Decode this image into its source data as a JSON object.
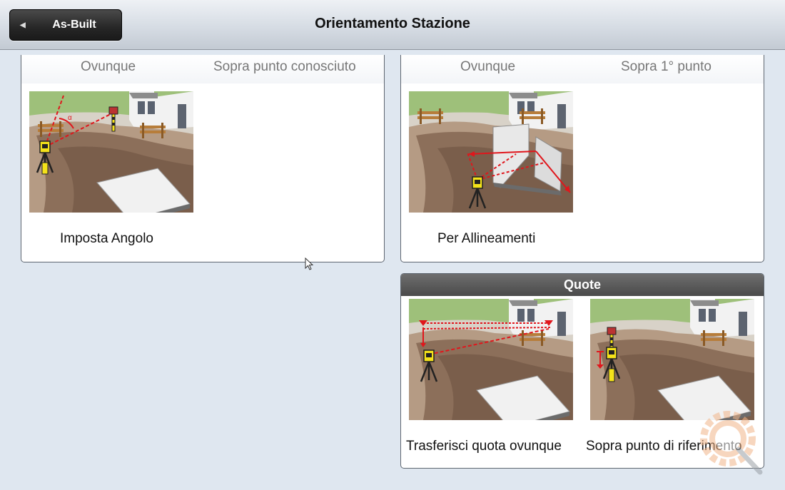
{
  "header": {
    "back_label": "As-Built",
    "title": "Orientamento Stazione"
  },
  "panels": {
    "left": {
      "tabs": [
        "Ovunque",
        "Sopra punto conosciuto"
      ],
      "tile_label": "Imposta Angolo"
    },
    "right": {
      "tabs": [
        "Ovunque",
        "Sopra 1° punto"
      ],
      "tile_label": "Per Allineamenti"
    },
    "quote": {
      "header": "Quote",
      "tiles": [
        "Trasferisci quota ovunque",
        "Sopra punto di riferimento"
      ]
    }
  },
  "colors": {
    "accent_red": "#e0161c",
    "instrument_yellow": "#f4e21a",
    "header_dark": "#2b2b2b"
  },
  "icons": [
    "back-arrow-icon",
    "mouse-cursor-icon",
    "magnifier-gear-watermark-icon"
  ]
}
